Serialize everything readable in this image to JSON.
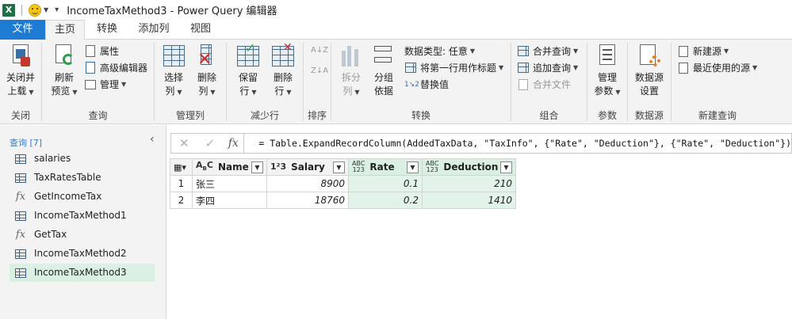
{
  "title": {
    "app_logo": "X",
    "text": "IncomeTaxMethod3 - Power Query 编辑器"
  },
  "tabs": [
    "文件",
    "主页",
    "转换",
    "添加列",
    "视图"
  ],
  "ribbon": {
    "close": {
      "btn1": "关闭并",
      "btn1b": "上载",
      "label": "关闭"
    },
    "query": {
      "refresh": "刷新",
      "refresh_b": "预览",
      "properties": "属性",
      "advanced": "高级编辑器",
      "manage": "管理",
      "label": "查询"
    },
    "columns": {
      "choose": "选择",
      "choose_b": "列",
      "remove": "删除",
      "remove_b": "列",
      "label": "管理列"
    },
    "rows": {
      "keep": "保留",
      "keep_b": "行",
      "remove": "删除",
      "remove_b": "行",
      "label": "减少行"
    },
    "sort": {
      "label": "排序"
    },
    "transform": {
      "split": "拆分",
      "split_b": "列",
      "group": "分组",
      "group_b": "依据",
      "datatype": "数据类型: 任意",
      "firstrow": "将第一行用作标题",
      "replace": "替换值",
      "label": "转换"
    },
    "combine": {
      "merge": "合并查询",
      "append": "追加查询",
      "files": "合并文件",
      "label": "组合"
    },
    "params": {
      "manage": "管理",
      "manage_b": "参数",
      "label": "参数"
    },
    "datasource": {
      "settings": "数据源",
      "settings_b": "设置",
      "label": "数据源"
    },
    "newquery": {
      "new": "新建源",
      "recent": "最近使用的源",
      "label": "新建查询"
    }
  },
  "queries": {
    "header": "查询 [7]",
    "items": [
      {
        "name": "salaries",
        "type": "table"
      },
      {
        "name": "TaxRatesTable",
        "type": "table"
      },
      {
        "name": "GetIncomeTax",
        "type": "function"
      },
      {
        "name": "IncomeTaxMethod1",
        "type": "table"
      },
      {
        "name": "GetTax",
        "type": "function"
      },
      {
        "name": "IncomeTaxMethod2",
        "type": "table"
      },
      {
        "name": "IncomeTaxMethod3",
        "type": "table",
        "active": true
      }
    ]
  },
  "formula": {
    "fx": "fx",
    "text": "= Table.ExpandRecordColumn(AddedTaxData, \"TaxInfo\", {\"Rate\", \"Deduction\"}, {\"Rate\", \"Deduction\"})"
  },
  "grid": {
    "columns": [
      {
        "name": "Name",
        "type": "ABC"
      },
      {
        "name": "Salary",
        "type": "123"
      },
      {
        "name": "Rate",
        "type": "ABC123"
      },
      {
        "name": "Deduction",
        "type": "ABC123"
      }
    ],
    "rows": [
      {
        "num": "1",
        "name": "张三",
        "salary": "8900",
        "rate": "0.1",
        "deduction": "210"
      },
      {
        "num": "2",
        "name": "李四",
        "salary": "18760",
        "rate": "0.2",
        "deduction": "1410"
      }
    ]
  }
}
